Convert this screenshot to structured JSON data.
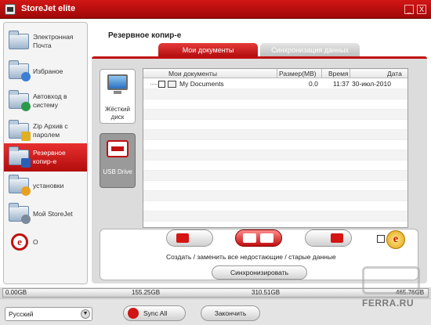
{
  "window": {
    "title": "StoreJet elite",
    "minimize": "_",
    "close": "X"
  },
  "sidebar": {
    "items": [
      {
        "label": "Электронная Почта",
        "icon": "folder-mail-icon"
      },
      {
        "label": "Избраное",
        "icon": "folder-favorites-icon"
      },
      {
        "label": "Автовход в систему",
        "icon": "folder-autologin-icon"
      },
      {
        "label": "Zip Архив с паролем",
        "icon": "folder-zip-icon"
      },
      {
        "label": "Резервное копир-е",
        "icon": "folder-backup-icon",
        "active": true
      },
      {
        "label": "установки",
        "icon": "folder-settings-icon"
      },
      {
        "label": "Мой StoreJet",
        "icon": "folder-mystorejet-icon"
      },
      {
        "label": "O",
        "icon": "ie-icon"
      }
    ]
  },
  "main": {
    "title": "Резервное копир-е",
    "tabs": [
      {
        "label": "Мои документы",
        "active": true
      },
      {
        "label": "Синхронизация данных",
        "active": false
      }
    ],
    "drives": [
      {
        "label": "Жёсткий диск",
        "selected": false
      },
      {
        "label": "USB Drive",
        "selected": true
      }
    ],
    "file_list": {
      "columns": [
        "Мои документы",
        "Размер(MB)",
        "Время",
        "Дата"
      ],
      "rows": [
        {
          "name": "My Documents",
          "size": "0.0",
          "time": "11:37",
          "date": "30-июл-2010"
        }
      ]
    },
    "actions": {
      "caption": "Создать / заменить все недостающие / старые данные",
      "sync_label": "Синхронизировать"
    }
  },
  "capacity": {
    "ticks": [
      "0.00GB",
      "155.25GB",
      "310.51GB",
      "465.76GB"
    ]
  },
  "footer": {
    "language": "Русский",
    "sync_all": "Sync All",
    "finish": "Закончить"
  },
  "watermark": {
    "text": "FERRA.RU"
  },
  "colors": {
    "accent": "#c01010",
    "frame": "#ffffff",
    "panel": "#dcdcdc"
  }
}
